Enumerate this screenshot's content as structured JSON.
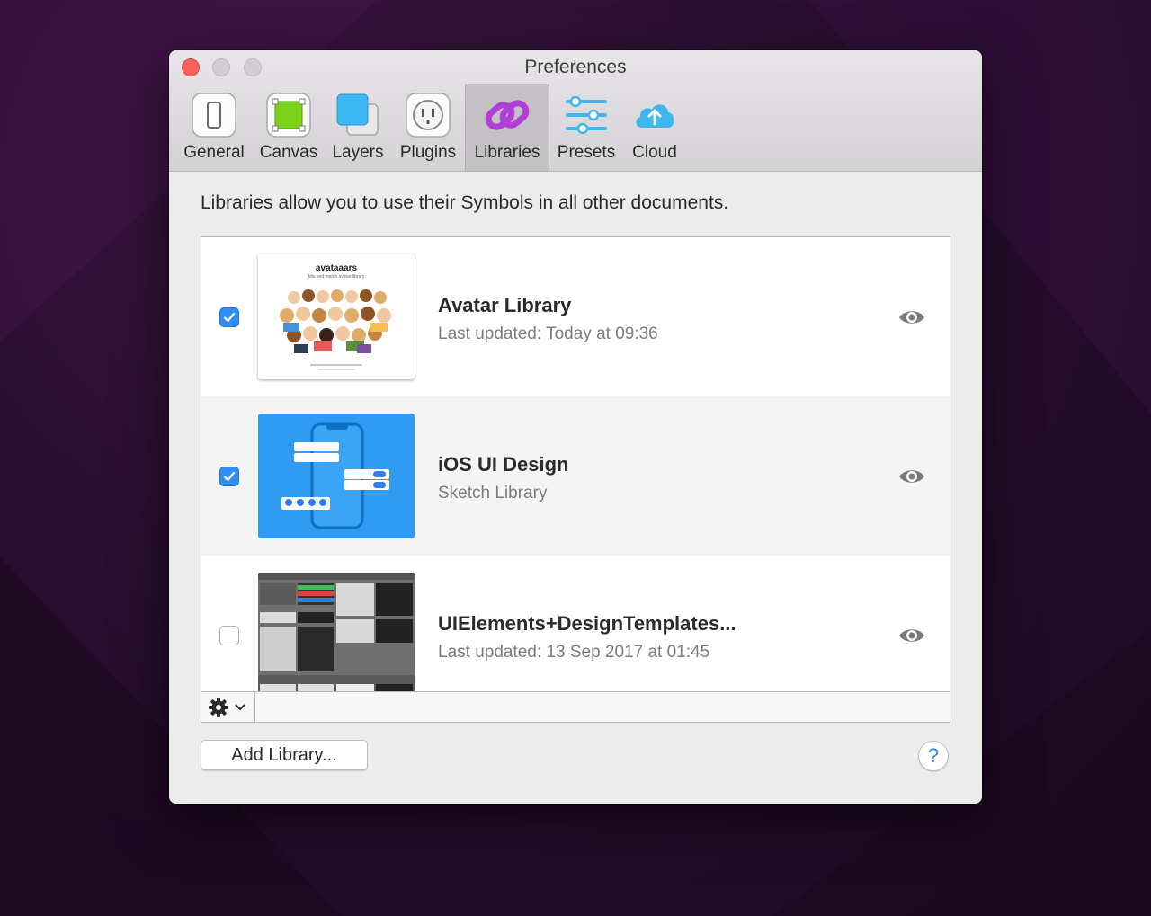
{
  "window": {
    "title": "Preferences"
  },
  "tabs": [
    {
      "label": "General",
      "icon": "general-icon",
      "active": false
    },
    {
      "label": "Canvas",
      "icon": "canvas-icon",
      "active": false
    },
    {
      "label": "Layers",
      "icon": "layers-icon",
      "active": false
    },
    {
      "label": "Plugins",
      "icon": "plugins-icon",
      "active": false
    },
    {
      "label": "Libraries",
      "icon": "libraries-icon",
      "active": true
    },
    {
      "label": "Presets",
      "icon": "presets-icon",
      "active": false
    },
    {
      "label": "Cloud",
      "icon": "cloud-icon",
      "active": false
    }
  ],
  "libraries_pane": {
    "intro": "Libraries allow you to use their Symbols in all other documents.",
    "items": [
      {
        "name": "Avatar Library",
        "subtitle": "Last updated: Today at 09:36",
        "enabled": true,
        "thumb_title": "avataaars",
        "thumb_subtitle": "Mix and match avatar library"
      },
      {
        "name": "iOS UI Design",
        "subtitle": "Sketch Library",
        "enabled": true
      },
      {
        "name": "UIElements+DesignTemplates...",
        "subtitle": "Last updated: 13 Sep 2017 at 01:45",
        "enabled": false
      }
    ],
    "add_button": "Add Library...",
    "help_button": "?"
  },
  "colors": {
    "accent": "#2f8ef5",
    "close": "#fc605c",
    "libraries_icon": "#b03fd8",
    "cloud_icon": "#3fb6ee"
  }
}
